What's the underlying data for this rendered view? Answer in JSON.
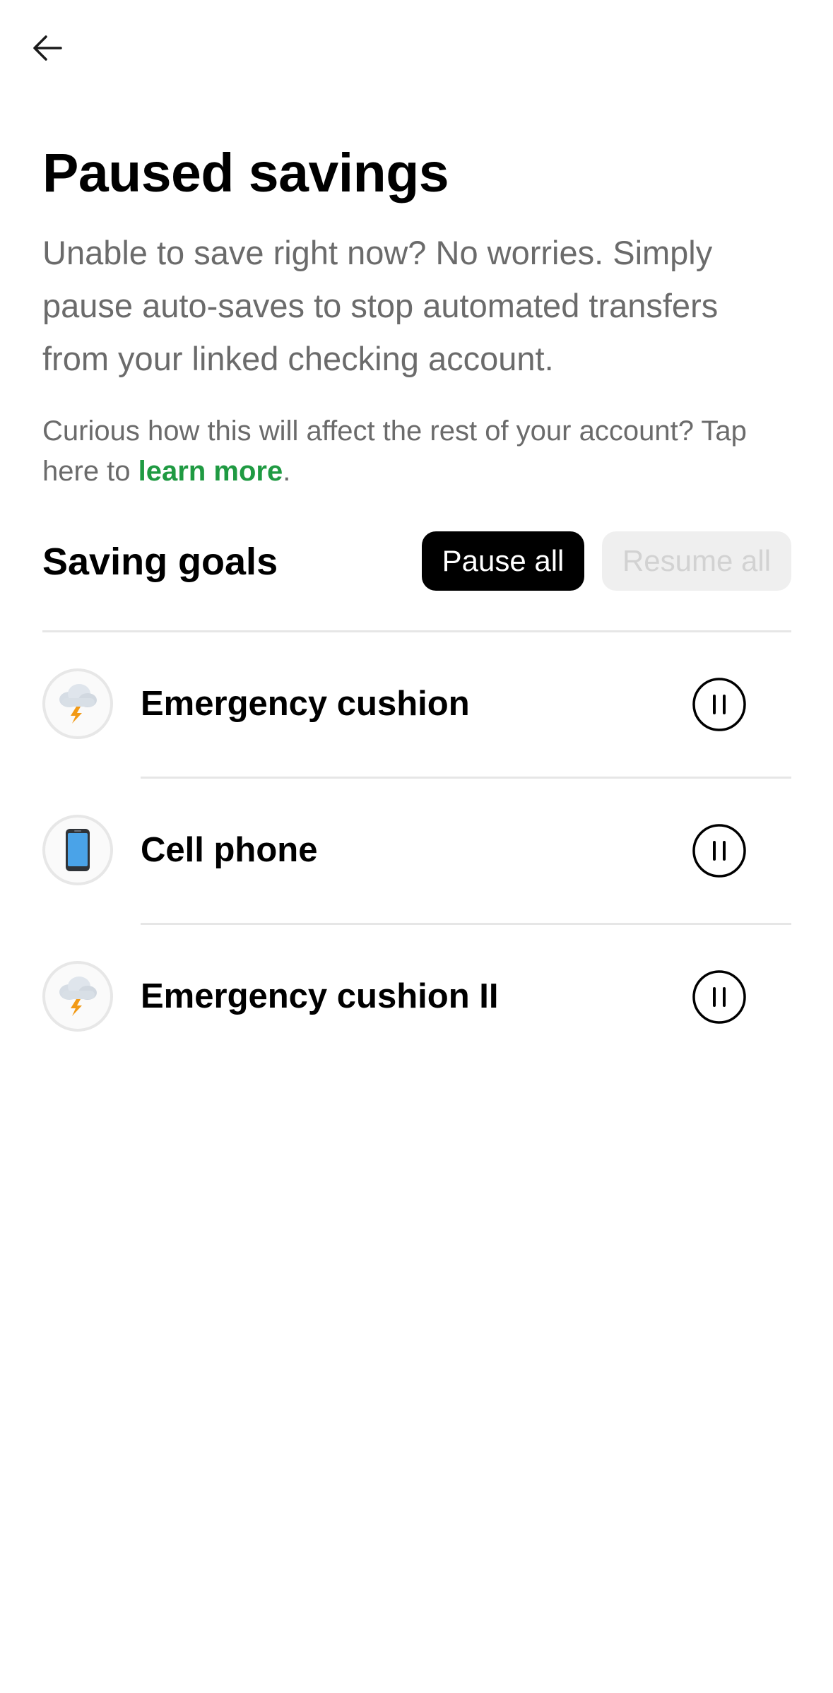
{
  "header": {
    "back_icon": "arrow-left-icon"
  },
  "page": {
    "title": "Paused savings",
    "intro": "Unable to save right now? No worries. Simply pause auto-saves to stop automated transfers from your linked checking account.",
    "curious_prefix": "Curious how this will affect the rest of your account? Tap here to ",
    "learn_more": "learn more",
    "curious_suffix": "."
  },
  "goals_section": {
    "title": "Saving goals",
    "pause_all_label": "Pause all",
    "resume_all_label": "Resume all",
    "items": [
      {
        "name": "Emergency cushion",
        "icon": "storm-cloud-icon",
        "action_icon": "pause-circle-icon"
      },
      {
        "name": "Cell phone",
        "icon": "mobile-phone-icon",
        "action_icon": "pause-circle-icon"
      },
      {
        "name": "Emergency cushion II",
        "icon": "storm-cloud-icon",
        "action_icon": "pause-circle-icon"
      }
    ]
  },
  "colors": {
    "link": "#1f9a42",
    "primary_button": "#000000",
    "disabled_button": "#efefef",
    "disabled_text": "#d2d2d2",
    "muted_text": "#6b6b6b"
  }
}
